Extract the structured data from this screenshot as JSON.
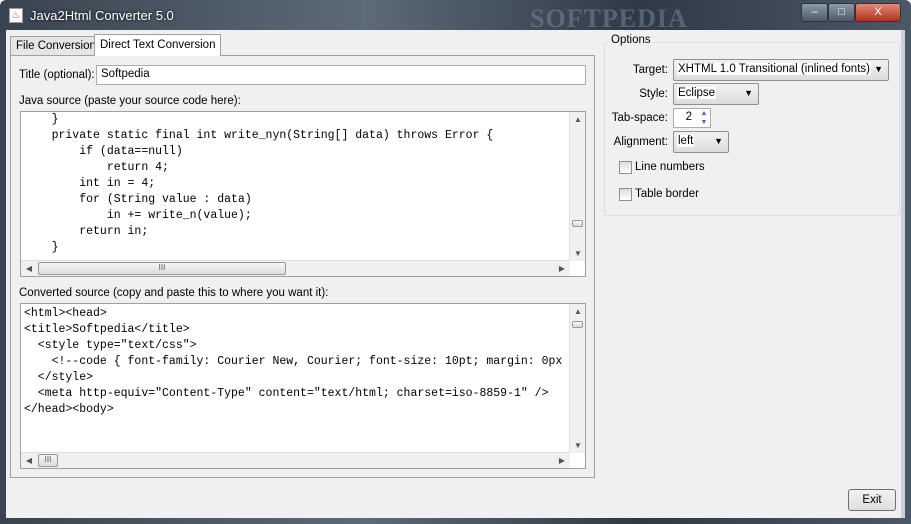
{
  "window": {
    "title": "Java2Html Converter 5.0",
    "watermark": "SOFTPEDIA",
    "minimize": "–",
    "maximize": "□",
    "close": "X"
  },
  "tabs": [
    {
      "label": "File Conversion"
    },
    {
      "label": "Direct Text Conversion"
    }
  ],
  "title_field": {
    "label": "Title (optional):",
    "value": "Softpedia"
  },
  "java_source": {
    "label": "Java source (paste your source code here):",
    "code": "    }\n    private static final int write_nyn(String[] data) throws Error {\n        if (data==null)\n            return 4;\n        int in = 4;\n        for (String value : data)\n            in += write_n(value);\n        return in;\n    }"
  },
  "converted": {
    "label": "Converted source (copy and paste this to where you want it):",
    "code": "<html><head>\n<title>Softpedia</title>\n  <style type=\"text/css\">\n    <!--code { font-family: Courier New, Courier; font-size: 10pt; margin: 0px\n  </style>\n  <meta http-equiv=\"Content-Type\" content=\"text/html; charset=iso-8859-1\" />\n</head><body>"
  },
  "options": {
    "title": "Options",
    "target": {
      "label": "Target:",
      "value": "XHTML 1.0 Transitional (inlined fonts)"
    },
    "style": {
      "label": "Style:",
      "value": "Eclipse"
    },
    "tab_space": {
      "label": "Tab-space:",
      "value": "2"
    },
    "alignment": {
      "label": "Alignment:",
      "value": "left"
    },
    "line_numbers": {
      "label": "Line numbers",
      "checked": false
    },
    "table_border": {
      "label": "Table border",
      "checked": false
    }
  },
  "exit_label": "Exit",
  "scroll_grip": "III"
}
